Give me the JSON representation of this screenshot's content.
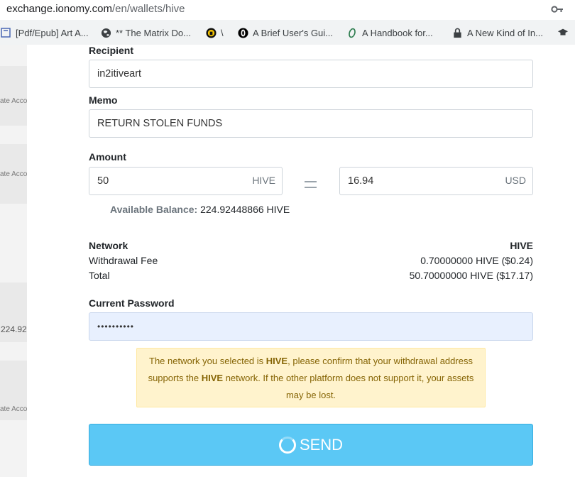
{
  "browser": {
    "url_host": "exchange.ionomy.com",
    "url_path": "/en/wallets/hive",
    "bookmarks": [
      {
        "label": "[Pdf/Epub] Art A...",
        "icon": "book-icon"
      },
      {
        "label": "** The Matrix Do...",
        "icon": "globe-icon"
      },
      {
        "label": "\\",
        "icon": "mascot-icon"
      },
      {
        "label": "A Brief User's Gui...",
        "icon": "o-logo-icon"
      },
      {
        "label": "A Handbook for...",
        "icon": "script-o-icon"
      },
      {
        "label": "A New Kind of In...",
        "icon": "lock-icon"
      }
    ]
  },
  "background": {
    "left_labels": [
      "ate Acco",
      "ate Acco",
      "ate Acco"
    ],
    "left_number": "224.92"
  },
  "form": {
    "recipient_label": "Recipient",
    "recipient_value": "in2itiveart",
    "memo_label": "Memo",
    "memo_value": "RETURN STOLEN FUNDS",
    "amount_label": "Amount",
    "amount_value": "50",
    "amount_currency": "HIVE",
    "equals_sign": "=",
    "usd_value": "16.94",
    "usd_currency": "USD",
    "available_label": "Available Balance:",
    "available_value": "224.92448866 HIVE"
  },
  "summary": {
    "network_label": "Network",
    "network_value": "HIVE",
    "fee_label": "Withdrawal Fee",
    "fee_value": "0.70000000 HIVE ($0.24)",
    "total_label": "Total",
    "total_value": "50.70000000 HIVE ($17.17)"
  },
  "password": {
    "label": "Current Password",
    "masked_value": "••••••••••"
  },
  "warning": {
    "part1": "The network you selected is ",
    "network1": "HIVE",
    "part2": ", please confirm that your withdrawal address supports the ",
    "network2": "HIVE",
    "part3": " network. If the other platform does not support it, your assets may be lost."
  },
  "send_button": {
    "label": "SEND"
  },
  "colors": {
    "send_bg": "#5bc8f5",
    "warning_bg": "#fff3cd",
    "password_bg": "#e8f0fe"
  }
}
